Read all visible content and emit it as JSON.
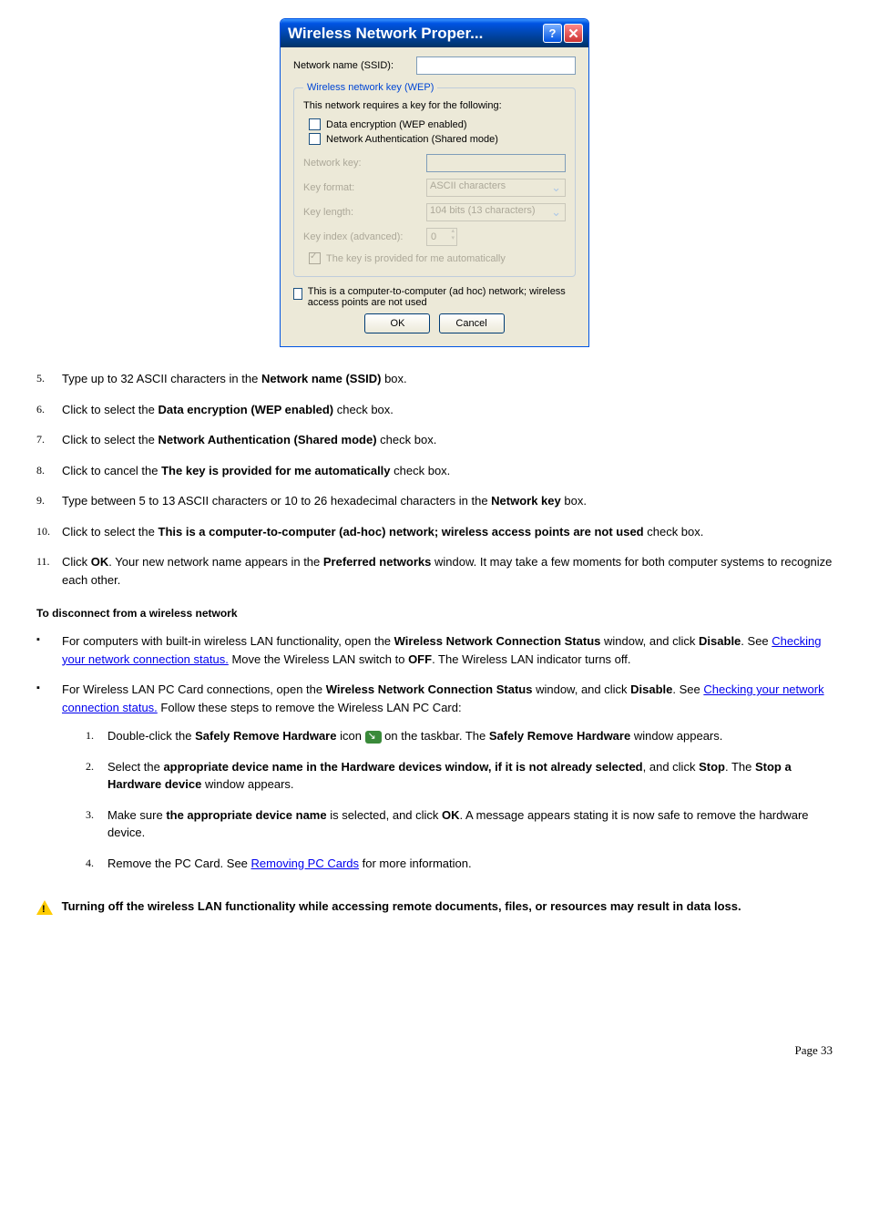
{
  "dialog": {
    "title": "Wireless Network Proper...",
    "help": "?",
    "close": "✕",
    "ssid_label": "Network name (SSID):",
    "group_legend": "Wireless network key (WEP)",
    "requires_text": "This network requires a key for the following:",
    "chk1": "Data encryption (WEP enabled)",
    "chk2": "Network Authentication (Shared mode)",
    "netkey_label": "Network key:",
    "keyfmt_label": "Key format:",
    "keyfmt_val": "ASCII characters",
    "keylen_label": "Key length:",
    "keylen_val": "104 bits (13 characters)",
    "keyidx_label": "Key index (advanced):",
    "keyidx_val": "0",
    "auto_chk": "The key is provided for me automatically",
    "adhoc_chk": "This is a computer-to-computer (ad hoc) network; wireless access points are not used",
    "ok": "OK",
    "cancel": "Cancel"
  },
  "steps": {
    "s5": {
      "n": "5.",
      "t1": "Type up to 32 ASCII characters in the ",
      "b": "Network name (SSID)",
      "t2": " box."
    },
    "s6": {
      "n": "6.",
      "t1": "Click to select the ",
      "b": "Data encryption (WEP enabled)",
      "t2": " check box."
    },
    "s7": {
      "n": "7.",
      "t1": "Click to select the ",
      "b": "Network Authentication (Shared mode)",
      "t2": " check box."
    },
    "s8": {
      "n": "8.",
      "t1": "Click to cancel the ",
      "b": "The key is provided for me automatically",
      "t2": " check box."
    },
    "s9": {
      "n": "9.",
      "t1": "Type between 5 to 13 ASCII characters or 10 to 26 hexadecimal characters in the ",
      "b": "Network key",
      "t2": " box."
    },
    "s10": {
      "n": "10.",
      "t1": "Click to select the ",
      "b": "This is a computer-to-computer (ad-hoc) network; wireless access points are not used",
      "t2": " check box."
    },
    "s11": {
      "n": "11.",
      "t1": "Click ",
      "b1": "OK",
      "t2": ". Your new network name appears in the ",
      "b2": "Preferred networks",
      "t3": " window. It may take a few moments for both computer systems to recognize each other."
    }
  },
  "disconnect_heading": "To disconnect from a wireless network",
  "bul1": {
    "t1": "For computers with built-in wireless LAN functionality, open the ",
    "b1": "Wireless Network Connection Status",
    "t2": " window, and click ",
    "b2": "Disable",
    "t3": ". See ",
    "link": "Checking your network connection status.",
    "t4": " Move the Wireless LAN switch to ",
    "b3": "OFF",
    "t5": ". The Wireless LAN indicator turns off."
  },
  "bul2": {
    "t1": "For Wireless LAN PC Card connections, open the ",
    "b1": "Wireless Network Connection Status",
    "t2": " window, and click ",
    "b2": "Disable",
    "t3": ". See ",
    "link": "Checking your network connection status.",
    "t4": " Follow these steps to remove the Wireless LAN PC Card:"
  },
  "nested": {
    "n1": {
      "n": "1.",
      "t1": "Double-click the ",
      "b1": "Safely Remove Hardware",
      "t2": " icon ",
      "t3": " on the taskbar. The ",
      "b2": "Safely Remove Hardware",
      "t4": " window appears."
    },
    "n2": {
      "n": "2.",
      "t1": "Select the ",
      "b1": "appropriate device name in the Hardware devices window, if it is not already selected",
      "t2": ", and click ",
      "b2": "Stop",
      "t3": ". The ",
      "b3": "Stop a Hardware device",
      "t4": " window appears."
    },
    "n3": {
      "n": "3.",
      "t1": "Make sure ",
      "b1": "the appropriate device name",
      "t2": " is selected, and click ",
      "b2": "OK",
      "t3": ". A message appears stating it is now safe to remove the hardware device."
    },
    "n4": {
      "n": "4.",
      "t1": "Remove the PC Card. See ",
      "link": "Removing PC Cards",
      "t2": " for more information."
    }
  },
  "warning": "Turning off the wireless LAN functionality while accessing remote documents, files, or resources may result in data loss.",
  "pagenum": "Page 33"
}
